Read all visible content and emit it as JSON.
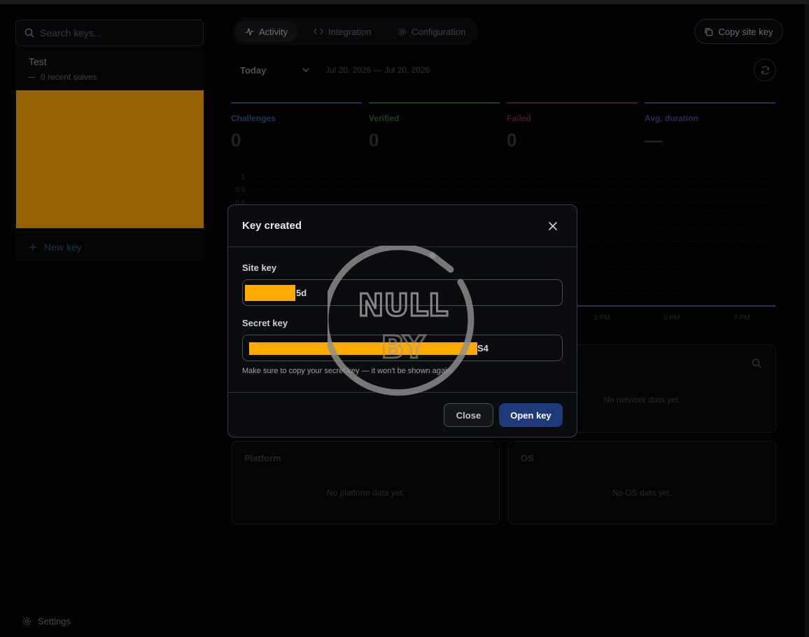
{
  "sidebar": {
    "search_placeholder": "Search keys...",
    "keys": [
      {
        "name": "Test",
        "sub": "0 recent solves"
      }
    ],
    "new_key_label": "New key",
    "settings_label": "Settings"
  },
  "nav": {
    "tabs": [
      {
        "label": "Activity",
        "icon": "activity-icon",
        "active": true
      },
      {
        "label": "Integration",
        "icon": "code-icon",
        "active": false
      },
      {
        "label": "Configuration",
        "icon": "gear-icon",
        "active": false
      }
    ],
    "copy_site_key_label": "Copy site key"
  },
  "filters": {
    "range_label": "Today",
    "date_range": "Jul 20, 2026 — Jul 20, 2026"
  },
  "stats": [
    {
      "label": "Challenges",
      "value": "0",
      "color": "#3b5a93"
    },
    {
      "label": "Verified",
      "value": "0",
      "color": "#3f6a3a"
    },
    {
      "label": "Failed",
      "value": "0",
      "color": "#7a2e3c"
    },
    {
      "label": "Avg. duration",
      "value": "—",
      "color": "#4a4a8a"
    }
  ],
  "chart_data": {
    "type": "line",
    "y_ticks": [
      "1",
      "0.9",
      "0.8"
    ],
    "x_ticks": [
      "3 PM",
      "5 PM",
      "7 PM"
    ],
    "ylim": [
      0,
      1
    ],
    "series": [
      {
        "values": [
          0,
          0,
          0
        ]
      }
    ],
    "grid": true
  },
  "panels": {
    "network": {
      "empty": "No network data yet."
    },
    "platform": {
      "title": "Platform",
      "empty": "No platform data yet."
    },
    "os": {
      "title": "OS",
      "empty": "No OS data yet."
    }
  },
  "modal": {
    "title": "Key created",
    "site_key_label": "Site key",
    "site_key_visible_suffix": "5d",
    "secret_key_label": "Secret key",
    "secret_key_visible_suffix": "S4",
    "note": "Make sure to copy your secret key — it won't be shown again.",
    "close_label": "Close",
    "open_label": "Open key"
  },
  "watermark": {
    "line1": "NULL",
    "line2": "BY"
  },
  "colors": {
    "accent": "#1e3a7a",
    "redaction": "#ffaa00",
    "background": "#050506"
  }
}
